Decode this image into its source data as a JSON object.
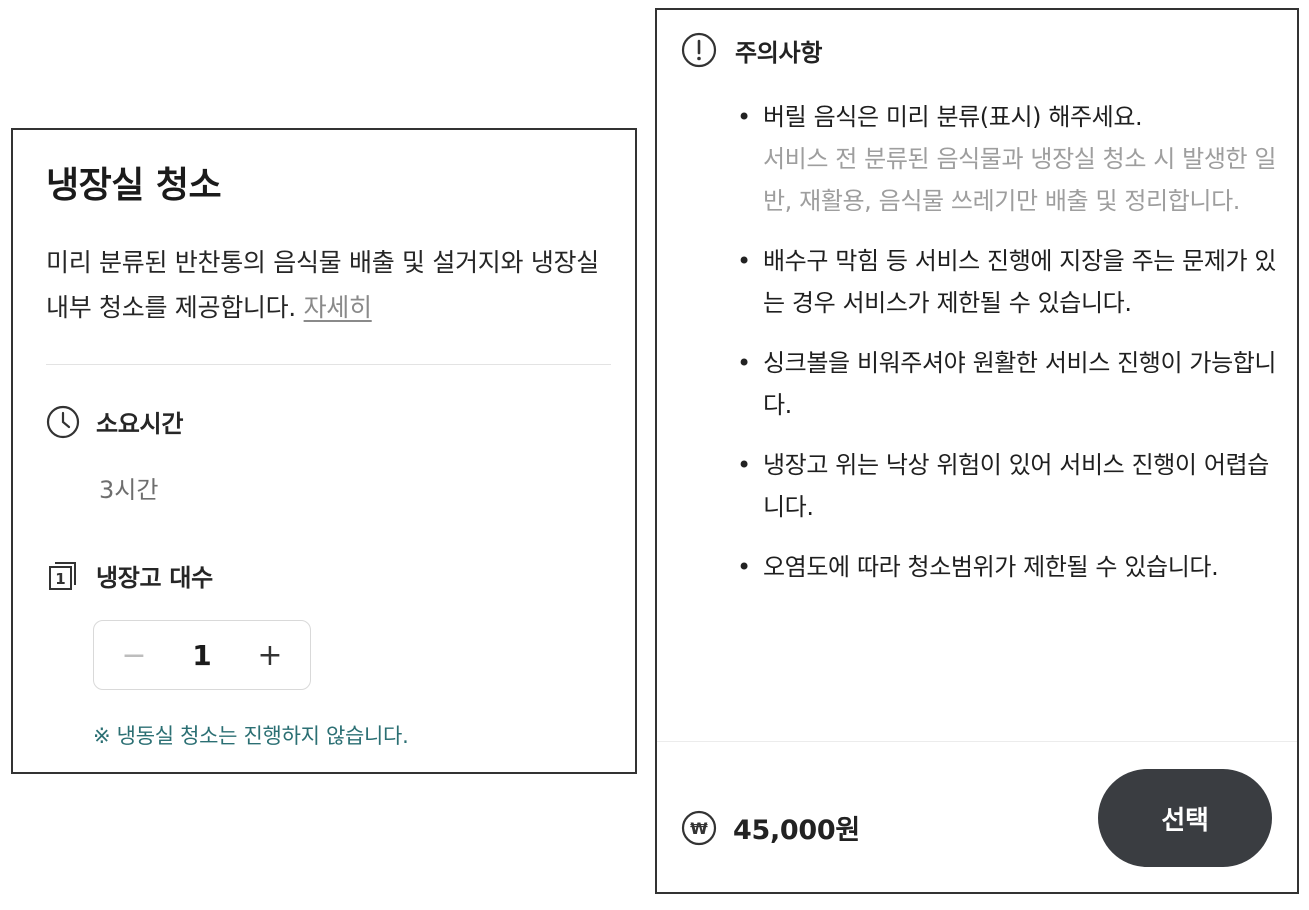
{
  "left_card": {
    "title": "냉장실 청소",
    "description": "미리 분류된 반찬통의 음식물 배출 및 설거지와 냉장실 내부 청소를 제공합니다.",
    "more_link": "자세히",
    "duration": {
      "label": "소요시간",
      "value": "3시간",
      "icon": "clock-icon"
    },
    "fridge_count": {
      "label": "냉장고 대수",
      "icon": "numbered-pages-icon",
      "icon_glyph": "1",
      "stepper": {
        "minus": "−",
        "value": "1",
        "plus": "+"
      }
    },
    "note": "※  냉동실 청소는 진행하지 않습니다."
  },
  "right_card": {
    "notice": {
      "label": "주의사항",
      "icon": "exclamation-circle-icon"
    },
    "bullets": [
      {
        "text": "버릴 음식은 미리 분류(표시) 해주세요.",
        "sub": "서비스 전 분류된 음식물과 냉장실 청소 시 발생한 일반, 재활용, 음식물 쓰레기만 배출 및 정리합니다."
      },
      {
        "text": "배수구 막힘 등 서비스 진행에 지장을 주는 문제가 있는 경우 서비스가 제한될 수 있습니다."
      },
      {
        "text": "싱크볼을 비워주셔야 원활한 서비스 진행이 가능합니다."
      },
      {
        "text": "냉장고 위는 낙상 위험이 있어 서비스 진행이 어렵습니다."
      },
      {
        "text": "오염도에 따라 청소범위가 제한될 수 있습니다."
      }
    ],
    "price": {
      "amount": "45,000원",
      "icon": "won-circle-icon",
      "icon_glyph": "₩"
    },
    "select_button": "선택"
  },
  "colors": {
    "note_teal": "#2b6f73",
    "button_dark": "#3a3d41",
    "muted_text": "#9e9e9e",
    "border": "#333333"
  }
}
